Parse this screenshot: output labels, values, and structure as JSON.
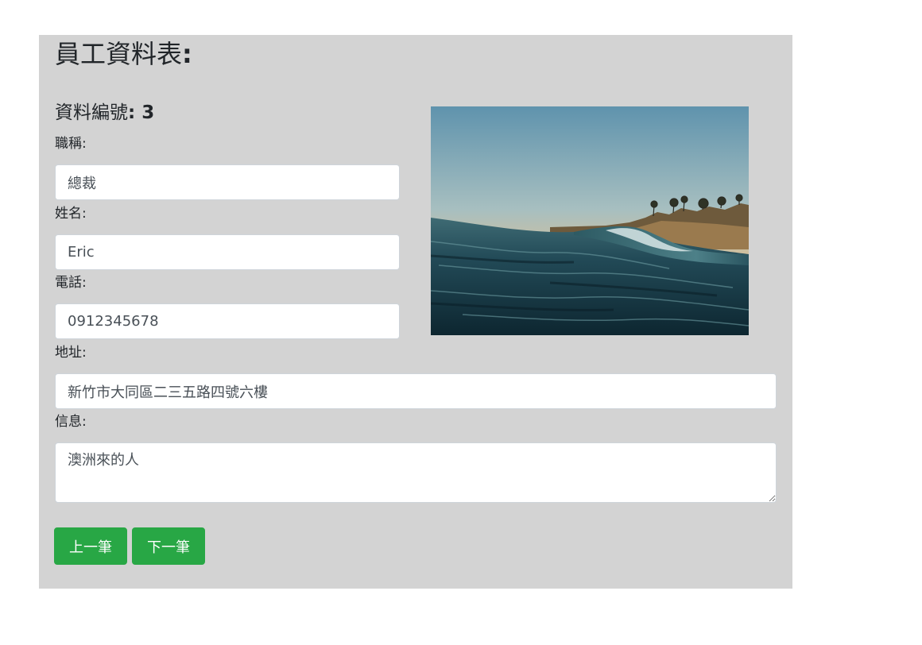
{
  "form": {
    "title": "員工資料表",
    "title_colon": ":",
    "record_label": "資料編號",
    "record_number": ": 3",
    "job_title_label": "職稱:",
    "job_title_value": "總裁",
    "name_label": "姓名:",
    "name_value": "Eric",
    "phone_label": "電話:",
    "phone_value": "0912345678",
    "address_label": "地址:",
    "address_value": "新竹市大同區二三五路四號六樓",
    "message_label": "信息:",
    "message_value": "澳洲來的人"
  },
  "photo": {
    "icon": "ocean-wave-photo",
    "sky_top": "#6f9db4",
    "sky_bottom": "#f0b070",
    "sea": "#163744"
  },
  "buttons": {
    "prev_label": "上一筆",
    "next_label": "下一筆",
    "color": "#28a745"
  }
}
